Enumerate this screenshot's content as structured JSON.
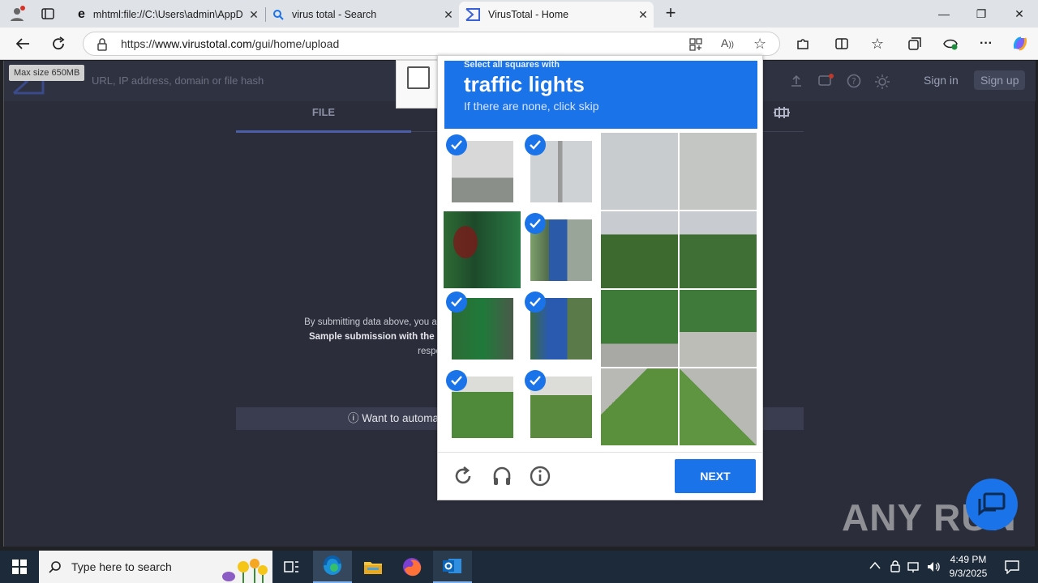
{
  "browser": {
    "tabs": [
      {
        "title": "mhtml:file://C:\\Users\\admin\\AppD",
        "icon": "ie-icon"
      },
      {
        "title": "virus total - Search",
        "icon": "search-icon"
      },
      {
        "title": "VirusTotal - Home",
        "icon": "virustotal-icon",
        "active": true
      }
    ],
    "url_prefix": "https://",
    "url_host": "www.virustotal.com",
    "url_path": "/gui/home/upload"
  },
  "page": {
    "tooltip": "Max size 650MB",
    "search_placeholder": "URL, IP address, domain or file hash",
    "sign_in": "Sign in",
    "sign_up": "Sign up",
    "file_tab": "FILE",
    "notice_line1": "By submitting data above, you are ag",
    "notice_line2": "Sample submission with the secu",
    "notice_line3": "responsib",
    "automate": "Want to automa"
  },
  "captcha": {
    "small": "Select all squares with",
    "title": "traffic lights",
    "subtitle": "If there are none, click skip",
    "next": "NEXT",
    "selected_tiles": [
      0,
      1,
      3,
      4,
      5,
      6,
      7
    ]
  },
  "taskbar": {
    "search_placeholder": "Type here to search",
    "time": "4:49 PM",
    "date": "9/3/2025"
  },
  "watermark": "ANY RUN",
  "colors": {
    "accent": "#1a73e8",
    "page_bg": "#2b2d3a"
  }
}
